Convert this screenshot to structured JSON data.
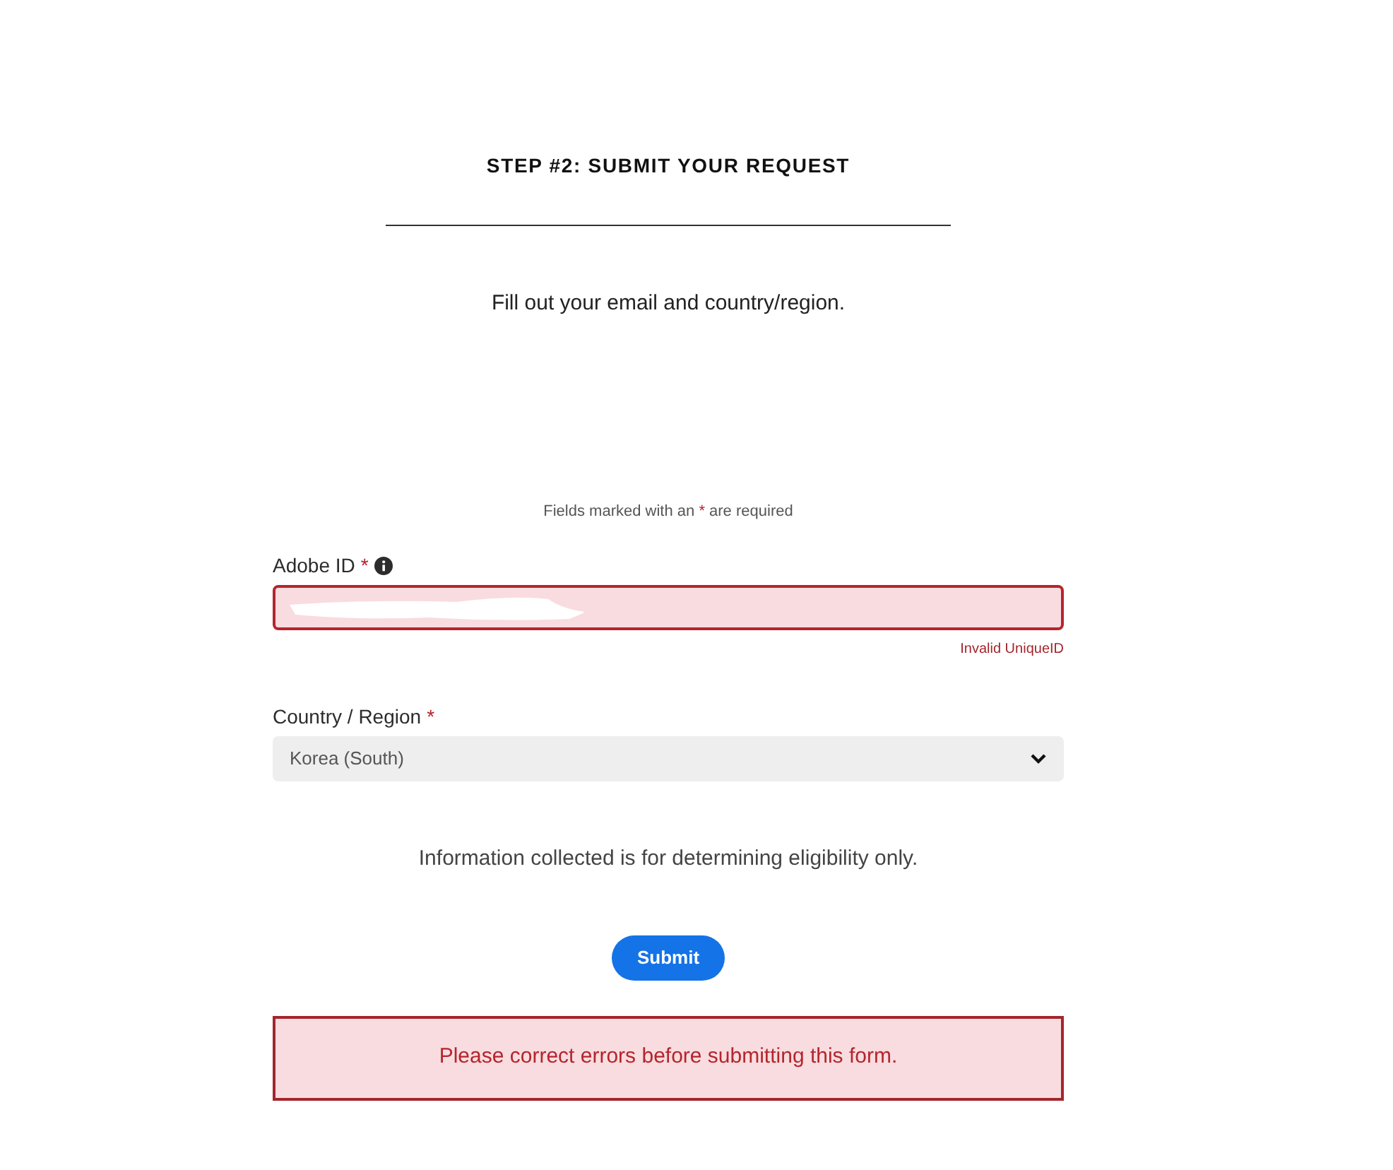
{
  "heading": "STEP #2: SUBMIT YOUR REQUEST",
  "subtitle": "Fill out your email and country/region.",
  "required_note": {
    "before": "Fields marked with an ",
    "mark": "*",
    "after": " are required"
  },
  "fields": [
    {
      "kind": "text",
      "label": "Adobe ID",
      "required_mark": "*",
      "has_info": true,
      "error": true,
      "redacted": true,
      "error_text": "Invalid UniqueID"
    },
    {
      "kind": "select",
      "label": "Country / Region",
      "required_mark": "*",
      "error": false,
      "value": "Korea (South)"
    }
  ],
  "info_text": "Information collected is for determining eligibility only.",
  "submit_label": "Submit",
  "error_banner": "Please correct errors before submitting this form."
}
